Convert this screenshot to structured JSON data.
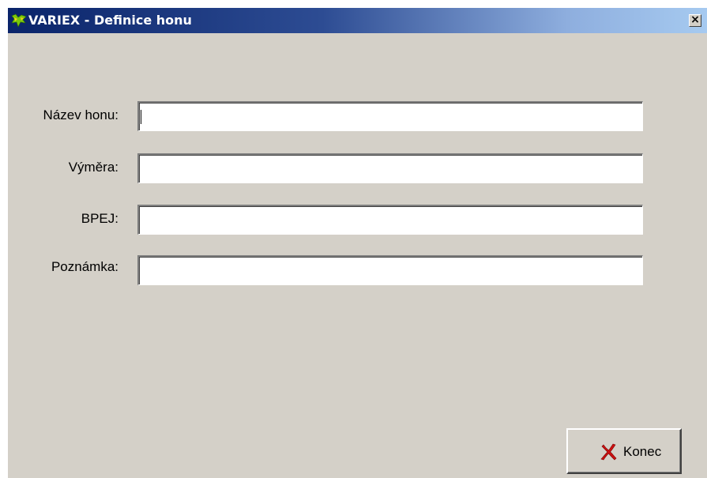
{
  "window": {
    "title": "VARIEX - Definice honu",
    "close_glyph": "×"
  },
  "form": {
    "fields": [
      {
        "label": "Název honu:",
        "value": ""
      },
      {
        "label": "Výměra:",
        "value": ""
      },
      {
        "label": "BPEJ:",
        "value": ""
      },
      {
        "label": "Poznámka:",
        "value": ""
      }
    ]
  },
  "buttons": {
    "konec_label": "Konec",
    "konec_icon": "red-x-icon"
  },
  "icons": {
    "app": "variex-app-icon",
    "close": "close-icon"
  },
  "colors": {
    "window_bg": "#d4d0c8",
    "title_start": "#0a246a",
    "title_end": "#a6caf0",
    "konec_icon": "#cc1111"
  }
}
